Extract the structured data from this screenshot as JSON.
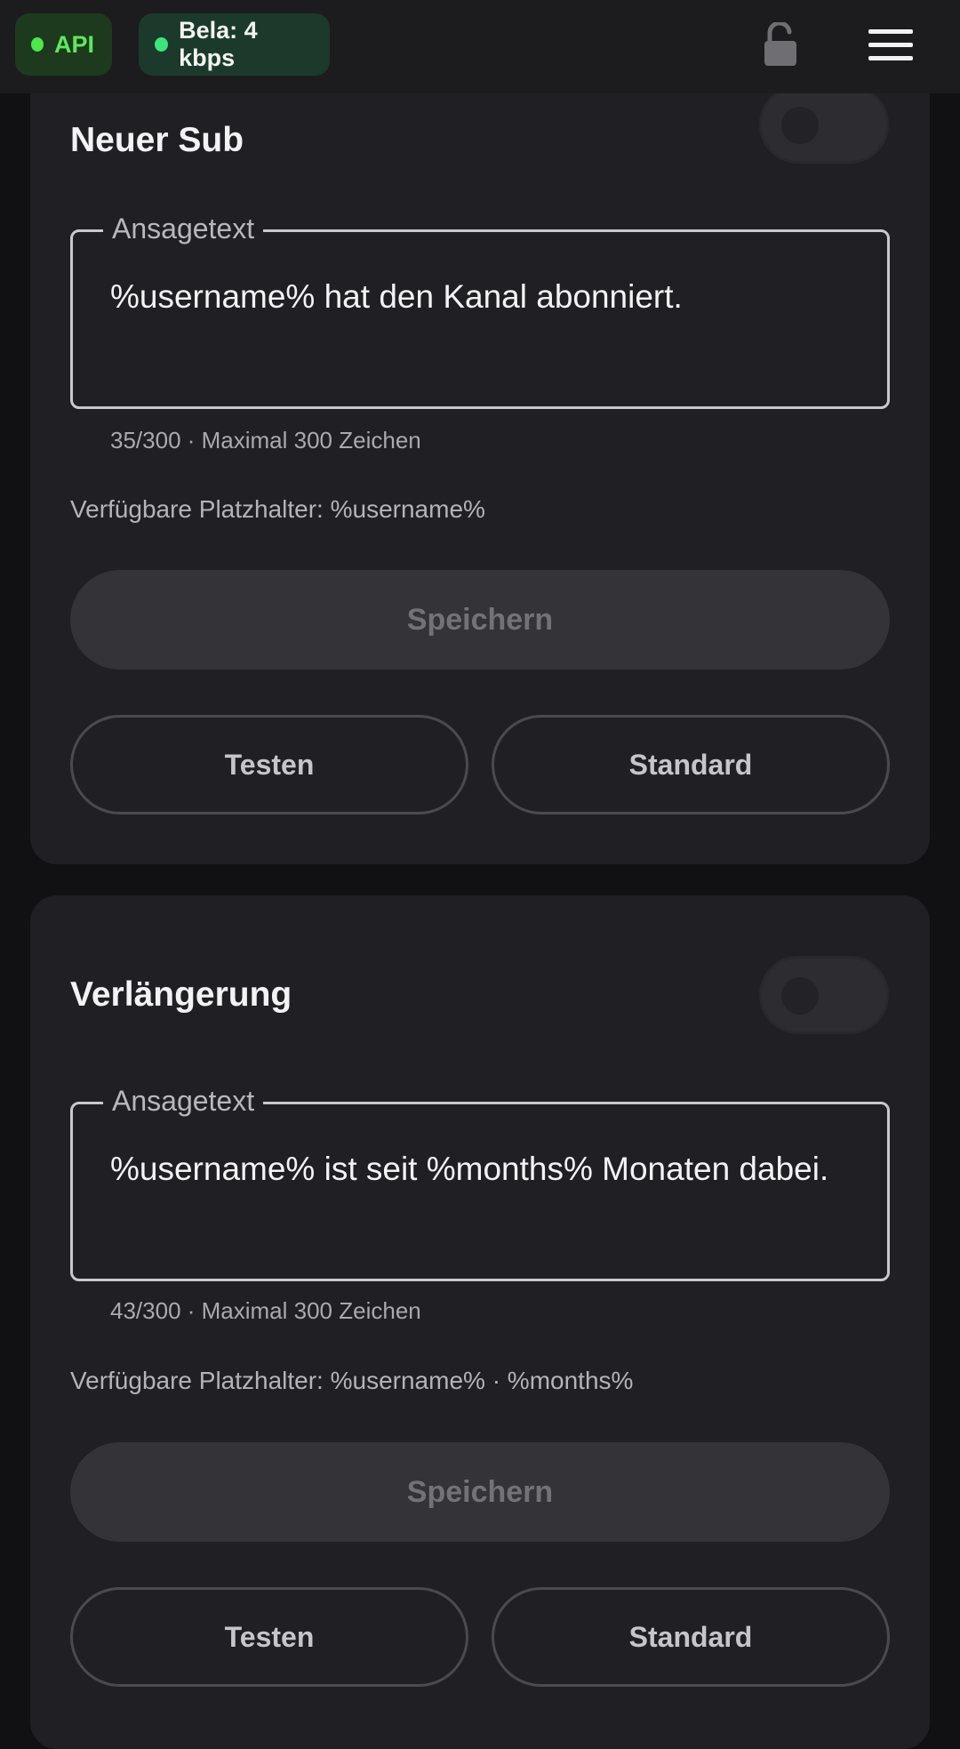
{
  "topbar": {
    "api_label": "API",
    "bela_label": "Bela: 4 kbps",
    "colors": {
      "api": "#4ee84a",
      "bela": "#3ee57d"
    },
    "lock_icon": "unlocked-padlock-icon",
    "menu_icon": "hamburger-menu-icon"
  },
  "cards": [
    {
      "title": "Neuer Sub",
      "toggle_on": false,
      "field_label": "Ansagetext",
      "field_value": "%username% hat den Kanal abonniert.",
      "counter": "35/300 · Maximal 300 Zeichen",
      "placeholders": "Verfügbare Platzhalter: %username%",
      "save_label": "Speichern",
      "test_label": "Testen",
      "default_label": "Standard"
    },
    {
      "title": "Verlängerung",
      "toggle_on": false,
      "field_label": "Ansagetext",
      "field_value": "%username% ist seit %months% Monaten dabei.",
      "counter": "43/300 · Maximal 300 Zeichen",
      "placeholders": "Verfügbare Platzhalter: %username% · %months%",
      "save_label": "Speichern",
      "test_label": "Testen",
      "default_label": "Standard"
    }
  ]
}
